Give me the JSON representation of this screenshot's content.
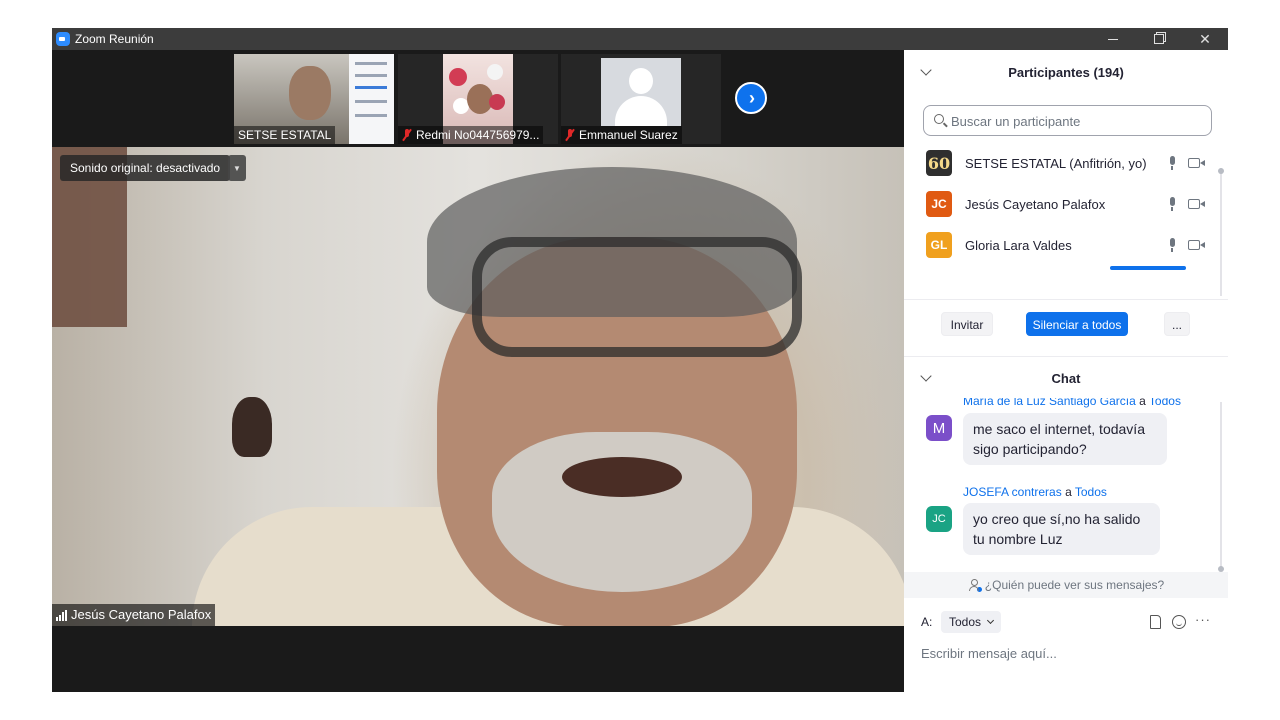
{
  "window": {
    "title": "Zoom Reunión"
  },
  "video": {
    "original_sound": "Sonido original: desactivado",
    "active_speaker": "Jesús Cayetano Palafox",
    "thumbnails": [
      {
        "label": "SETSE ESTATAL",
        "muted": false
      },
      {
        "label": "Redmi No044756979...",
        "muted": true
      },
      {
        "label": "Emmanuel Suarez",
        "muted": true
      }
    ],
    "next_page_glyph": "›"
  },
  "participants": {
    "title": "Participantes (194)",
    "search_placeholder": "Buscar un participante",
    "items": [
      {
        "name": "SETSE ESTATAL (Anfitrión, yo)",
        "initials": "60",
        "color": "#3a3a3a"
      },
      {
        "name": "Jesús Cayetano Palafox",
        "initials": "JC",
        "color": "#e05a12"
      },
      {
        "name": "Gloria  Lara Valdes",
        "initials": "GL",
        "color": "#f0a01e"
      }
    ],
    "invite_label": "Invitar",
    "mute_all_label": "Silenciar a todos",
    "more_label": "..."
  },
  "chat": {
    "title": "Chat",
    "messages": [
      {
        "sender": "María de la Luz Santiago García",
        "to_word": "a",
        "recipient": "Todos",
        "avatar": "M",
        "avatar_color": "#7b4fc9",
        "text_lines": [
          "me saco el internet, todavía",
          "sigo participando?"
        ]
      },
      {
        "sender": "JOSEFA contreras",
        "to_word": "a",
        "recipient": "Todos",
        "avatar": "JC",
        "avatar_color": "#1aa384",
        "text_lines": [
          "yo creo que sí,no ha salido",
          "tu nombre Luz"
        ]
      }
    ],
    "who_can_see": "¿Quién puede ver sus mensajes?",
    "to_label": "A:",
    "recipient_value": "Todos",
    "more_label": "···",
    "input_placeholder": "Escribir mensaje aquí..."
  }
}
